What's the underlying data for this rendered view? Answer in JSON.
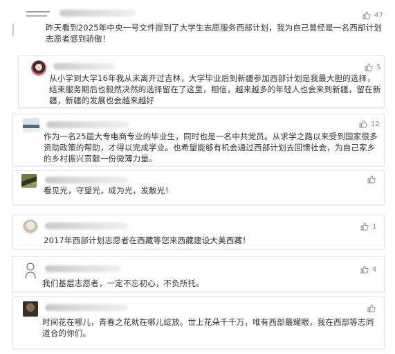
{
  "comments": [
    {
      "likes": "47",
      "text": "昨天看到2025年中央一号文件提到了大学生志愿服务西部计划，我为自己曾经是一名西部计划志愿者感到骄傲！"
    },
    {
      "likes": "5",
      "text": "从小学到大学16年我从未离开过吉林，大学毕业后到新疆参加西部计划是我最大胆的选择，结束服务期后也毅然决然的选择留在了这里，相信，越来越多的年轻人也会来到新疆，留在新疆，新疆的发展也会越来越好"
    },
    {
      "likes": "12",
      "text": "作为一名25届大专电商专业的毕业生，同时也是一名中共党员。从求学之路以来受到国家很多资助政策的帮助，才得以完成学业。也希望能够有机会通过西部计划去回馈社会，为自己家乡的乡村振兴贡献一份微薄力量。"
    },
    {
      "likes": "",
      "text": "看见光，守望光，成为光，发散光！"
    },
    {
      "likes": "1",
      "text": "2017年西部计划志愿者在西藏等您来西藏建设大美西藏！"
    },
    {
      "likes": "4",
      "text": "我们基层志愿者，一定不忘初心，不负所托。"
    },
    {
      "likes": "",
      "text": "时间花在哪儿，青春之花就在哪儿绽放。世上花朵千千万，唯有西部最耀眼，我在西部等志同道合的你们。"
    }
  ],
  "colors": {
    "text": "#333333",
    "like": "#8a8a8a",
    "border": "#e4e4e4"
  },
  "icons": {
    "like": "thumbs-up-icon"
  }
}
